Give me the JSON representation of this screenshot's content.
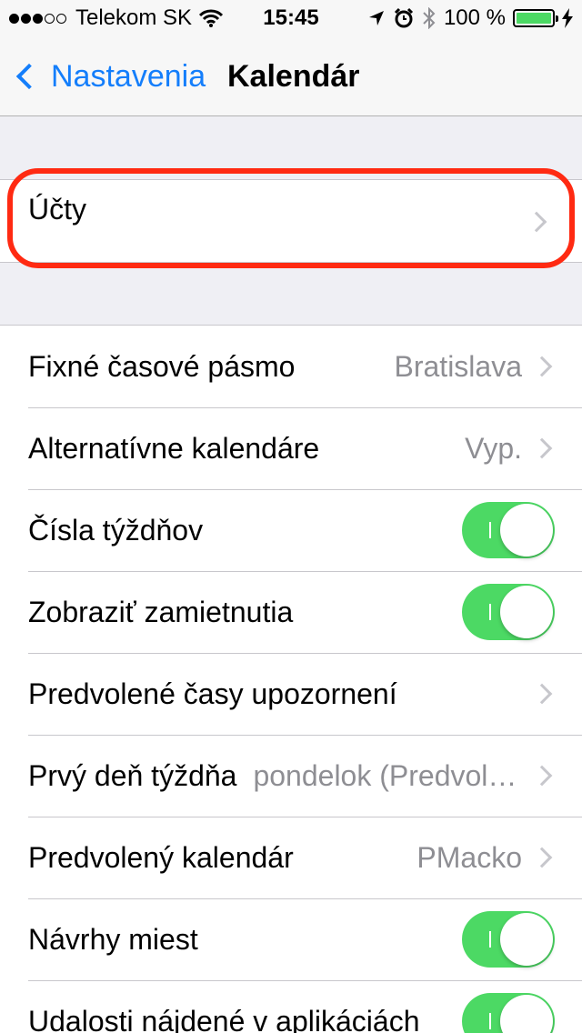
{
  "status_bar": {
    "carrier": "Telekom SK",
    "time": "15:45",
    "battery_percent": "100 %",
    "signal_bars_full": 3,
    "signal_bars_total": 5,
    "icons": [
      "wifi-icon",
      "location-icon",
      "alarm-icon",
      "bluetooth-icon",
      "battery-icon",
      "charging-icon"
    ]
  },
  "nav": {
    "back_label": "Nastavenia",
    "title": "Kalendár"
  },
  "accounts": {
    "label": "Účty"
  },
  "settings": [
    {
      "label": "Fixné časové pásmo",
      "value": "Bratislava",
      "type": "link"
    },
    {
      "label": "Alternatívne kalendáre",
      "value": "Vyp.",
      "type": "link"
    },
    {
      "label": "Čísla týždňov",
      "type": "toggle",
      "on": true
    },
    {
      "label": "Zobraziť zamietnutia",
      "type": "toggle",
      "on": true
    },
    {
      "label": "Predvolené časy upozornení",
      "value": "",
      "type": "link"
    },
    {
      "label": "Prvý deň týždňa",
      "value": "pondelok (Predvolené)",
      "type": "link"
    },
    {
      "label": "Predvolený kalendár",
      "value": "PMacko",
      "type": "link"
    },
    {
      "label": "Návrhy miest",
      "type": "toggle",
      "on": true
    },
    {
      "label": "Udalosti nájdené v aplikáciách",
      "type": "toggle",
      "on": true
    }
  ],
  "colors": {
    "accent": "#147efb",
    "toggle_on": "#4cd964",
    "highlight": "#ff2a12",
    "background": "#efeff4"
  }
}
